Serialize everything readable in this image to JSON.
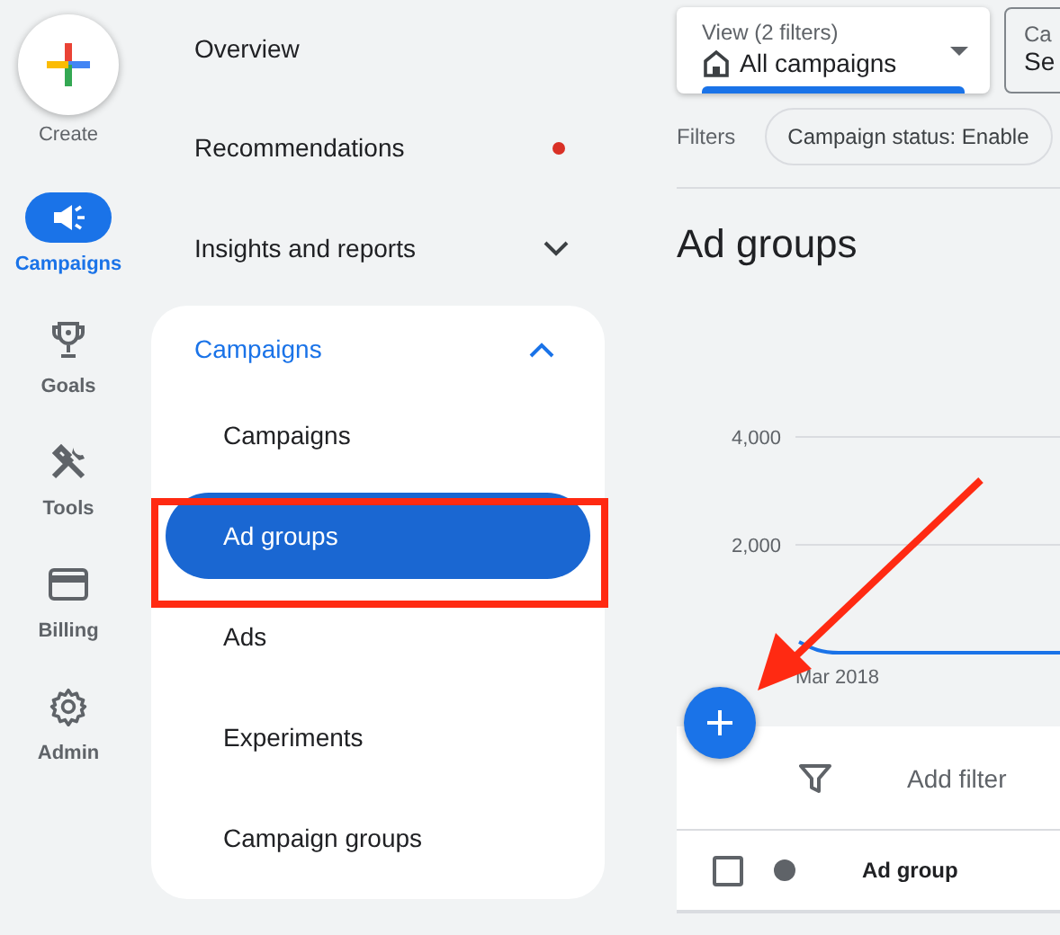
{
  "rail": {
    "create": {
      "label": "Create"
    },
    "items": [
      {
        "label": "Campaigns",
        "kind": "megaphone",
        "selected": true
      },
      {
        "label": "Goals",
        "kind": "trophy",
        "selected": false
      },
      {
        "label": "Tools",
        "kind": "tools",
        "selected": false
      },
      {
        "label": "Billing",
        "kind": "card",
        "selected": false
      },
      {
        "label": "Admin",
        "kind": "gear",
        "selected": false
      }
    ]
  },
  "nav": {
    "items": [
      {
        "label": "Overview",
        "notification": false
      },
      {
        "label": "Recommendations",
        "notification": true
      },
      {
        "label": "Insights and reports",
        "notification": false,
        "expanded": false
      }
    ],
    "group": {
      "label": "Campaigns",
      "expanded": true,
      "children": [
        {
          "label": "Campaigns",
          "selected": false
        },
        {
          "label": "Ad groups",
          "selected": true
        },
        {
          "label": "Ads",
          "selected": false
        },
        {
          "label": "Experiments",
          "selected": false
        },
        {
          "label": "Campaign groups",
          "selected": false
        }
      ]
    }
  },
  "main": {
    "view_selector": {
      "label": "View (2 filters)",
      "value": "All campaigns"
    },
    "second_selector": {
      "label": "Ca",
      "value": "Se"
    },
    "filters": {
      "label": "Filters",
      "chips": [
        "Campaign status: Enable"
      ]
    },
    "title": "Ad groups",
    "chart": {
      "y_labels": [
        "4,000",
        "2,000"
      ],
      "x_label": "Mar 2018"
    },
    "table": {
      "filter_placeholder": "Add filter",
      "columns": [
        {
          "kind": "checkbox",
          "checked": false
        },
        {
          "kind": "status"
        },
        {
          "kind": "text",
          "label": "Ad group"
        }
      ]
    }
  },
  "annotations": {
    "highlight_box": true,
    "arrow": true
  }
}
